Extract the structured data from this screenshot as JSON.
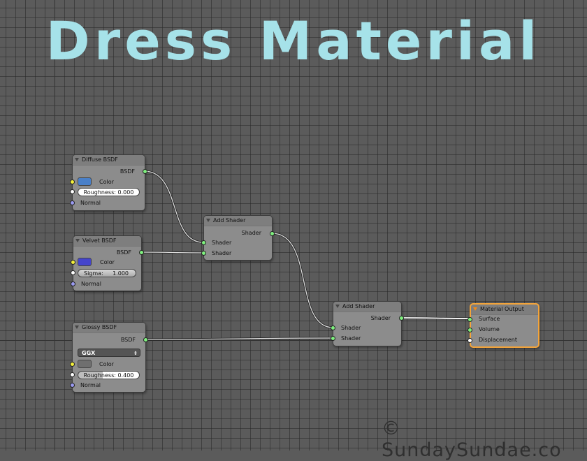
{
  "title": "Dress Material",
  "watermark": "© SundaySundae.co",
  "nodes": {
    "diffuse": {
      "title": "Diffuse BSDF",
      "output": "BSDF",
      "color_label": "Color",
      "color": "#4a80c8",
      "roughness": "Roughness: 0.000",
      "normal": "Normal"
    },
    "velvet": {
      "title": "Velvet BSDF",
      "output": "BSDF",
      "color_label": "Color",
      "color": "#4444cc",
      "sigma_label": "Sigma:",
      "sigma_value": "1.000",
      "normal": "Normal"
    },
    "glossy": {
      "title": "Glossy BSDF",
      "output": "BSDF",
      "distribution": "GGX",
      "color_label": "Color",
      "color": "#6f6f6f",
      "roughness": "Roughness: 0.400",
      "roughness_fraction": 0.4,
      "normal": "Normal"
    },
    "add1": {
      "title": "Add Shader",
      "output": "Shader",
      "input1": "Shader",
      "input2": "Shader"
    },
    "add2": {
      "title": "Add Shader",
      "output": "Shader",
      "input1": "Shader",
      "input2": "Shader"
    },
    "output": {
      "title": "Material Output",
      "surface": "Surface",
      "volume": "Volume",
      "displacement": "Displacement"
    }
  },
  "colors": {
    "title": "#a6e2e9",
    "active_border": "#f3a43a",
    "shader_socket": "#7ff07f"
  }
}
